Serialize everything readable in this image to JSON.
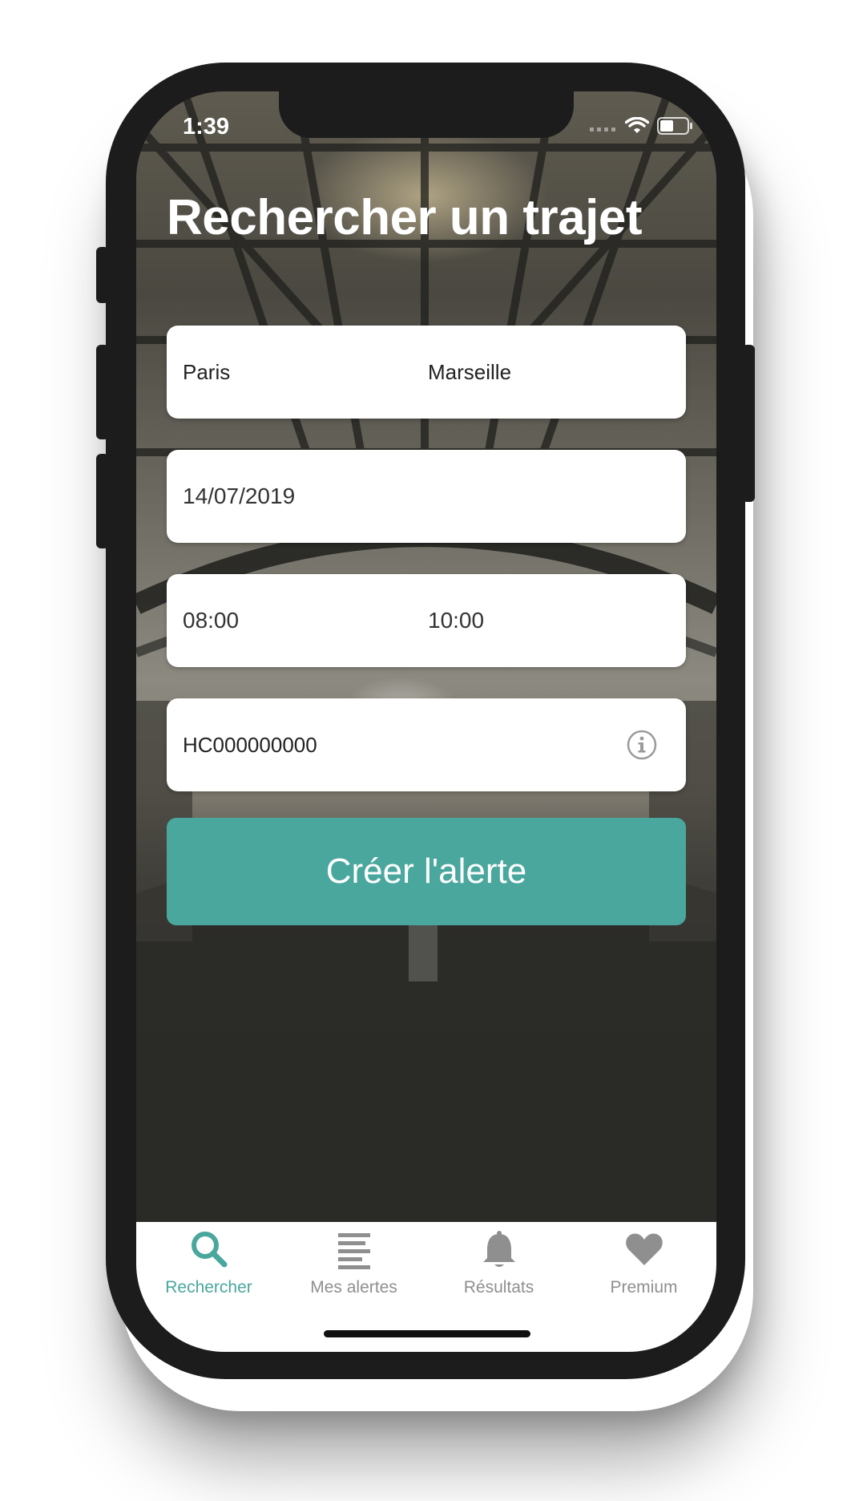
{
  "status_bar": {
    "time": "1:39",
    "icons": [
      "signal-icon",
      "wifi-icon",
      "battery-icon"
    ]
  },
  "page": {
    "title": "Rechercher un trajet"
  },
  "form": {
    "route": {
      "from": "Paris",
      "to": "Marseille"
    },
    "date": "14/07/2019",
    "times": {
      "start": "08:00",
      "end": "10:00"
    },
    "card_code": "HC000000000",
    "info_icon": "info-icon",
    "submit_label": "Créer l'alerte"
  },
  "tabs": [
    {
      "label": "Rechercher",
      "icon": "search-icon",
      "active": true
    },
    {
      "label": "Mes alertes",
      "icon": "list-icon",
      "active": false
    },
    {
      "label": "Résultats",
      "icon": "bell-icon",
      "active": false
    },
    {
      "label": "Premium",
      "icon": "heart-icon",
      "active": false
    }
  ],
  "colors": {
    "accent": "#4aa79d",
    "inactive_tab": "#8f8f8f",
    "device_frame": "#1c1c1c"
  }
}
